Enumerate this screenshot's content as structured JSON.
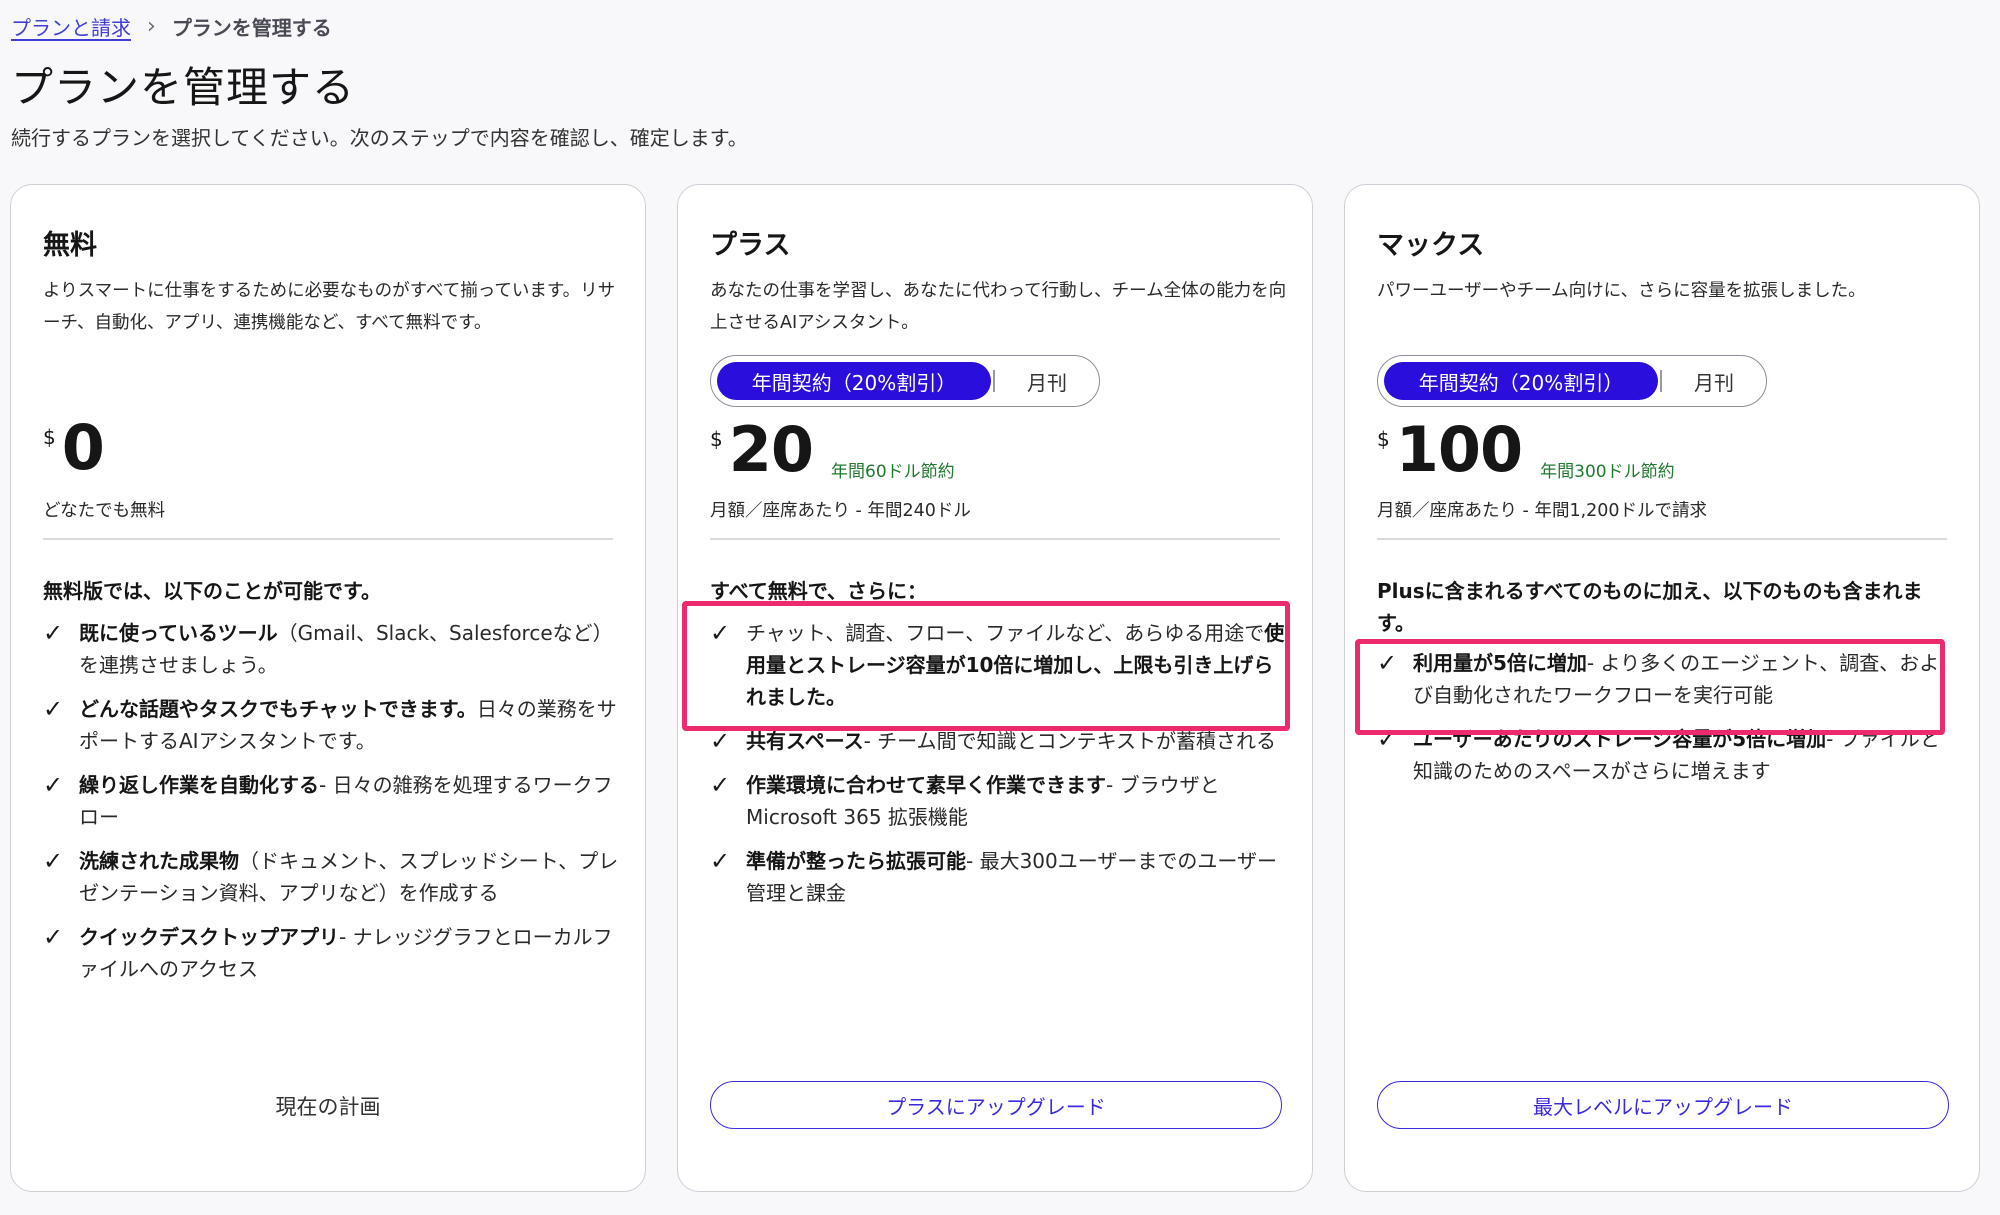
{
  "breadcrumb": {
    "parent": "プランと請求",
    "separator": "›",
    "current": "プランを管理する"
  },
  "title": "プランを管理する",
  "subtitle": "続行するプランを選択してください。次のステップで内容を確認し、確定します。",
  "colors": {
    "accent": "#2a0fdc",
    "savings": "#1f7a2e",
    "highlight": "#ee2a6f"
  },
  "plans": [
    {
      "name": "無料",
      "description": "よりスマートに仕事をするために必要なものがすべて揃っています。リサーチ、自動化、アプリ、連携機能など、すべて無料です。",
      "currency": "$",
      "price": "0",
      "price_note": "どなたでも無料",
      "features_heading": "無料版では、以下のことが可能です。",
      "features": [
        {
          "bold": "既に使っているツール",
          "text": "（Gmail、Slack、Salesforceなど）を連携させましょう。"
        },
        {
          "bold": "どんな話題やタスクでもチャットできます。",
          "text": "日々の業務をサポートするAIアシスタントです。"
        },
        {
          "bold": "繰り返し作業を自動化する",
          "text": "- 日々の雑務を処理するワークフロー"
        },
        {
          "bold": "洗練された成果物",
          "text": "（ドキュメント、スプレッドシート、プレゼンテーション資料、アプリなど）を作成する"
        },
        {
          "bold": "クイックデスクトップアプリ",
          "text": "- ナレッジグラフとローカルファイルへのアクセス"
        }
      ],
      "status_label": "現在の計画"
    },
    {
      "name": "プラス",
      "description": "あなたの仕事を学習し、あなたに代わって行動し、チーム全体の能力を向上させるAIアシスタント。",
      "toggle": {
        "active": "年間契約（20%割引）",
        "inactive": "月刊"
      },
      "currency": "$",
      "price": "20",
      "savings": "年間60ドル節約",
      "price_note": "月額／座席あたり - 年間240ドル",
      "features_heading": "すべて無料で、さらに：",
      "features": [
        {
          "pre": "チャット、調査、フロー、ファイルなど、あらゆる用途で",
          "bold": "使用量とストレージ容量が10倍に増加し、上限も引き上げられました。",
          "text": ""
        },
        {
          "bold": "共有スペース",
          "text": "- チーム間で知識とコンテキストが蓄積される"
        },
        {
          "bold": "作業環境に合わせて素早く作業できます",
          "text": "- ブラウザとMicrosoft 365 拡張機能"
        },
        {
          "bold": "準備が整ったら拡張可能",
          "text": "- 最大300ユーザーまでのユーザー管理と課金"
        }
      ],
      "cta_label": "プラスにアップグレード"
    },
    {
      "name": "マックス",
      "description": "パワーユーザーやチーム向けに、さらに容量を拡張しました。",
      "toggle": {
        "active": "年間契約（20%割引）",
        "inactive": "月刊"
      },
      "currency": "$",
      "price": "100",
      "savings": "年間300ドル節約",
      "price_note": "月額／座席あたり - 年間1,200ドルで請求",
      "features_heading": "Plusに含まれるすべてのものに加え、以下のものも含まれます。",
      "features": [
        {
          "bold": "利用量が5倍に増加",
          "text": "- より多くのエージェント、調査、および自動化されたワークフローを実行可能"
        },
        {
          "bold": "ユーザーあたりのストレージ容量が5倍に増加",
          "text": "- ファイルと知識のためのスペースがさらに増えます"
        }
      ],
      "cta_label": "最大レベルにアップグレード"
    }
  ]
}
